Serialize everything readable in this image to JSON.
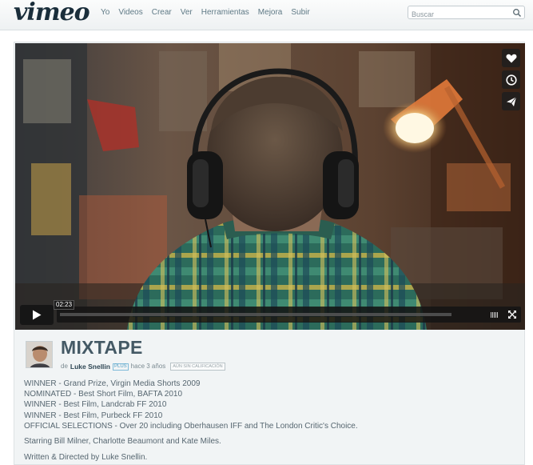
{
  "header": {
    "logo": "vimeo",
    "nav": [
      "Yo",
      "Videos",
      "Crear",
      "Ver",
      "Herramientas",
      "Mejora",
      "Subir"
    ],
    "search_placeholder": "Buscar"
  },
  "player": {
    "elapsed_time": "02:23",
    "side_buttons": [
      "heart-icon",
      "clock-icon",
      "send-icon"
    ]
  },
  "video": {
    "title": "MIXTAPE",
    "by_prefix": "de",
    "author": "Luke Snellin",
    "plus_badge": "PLUS",
    "posted": "hace 3 años",
    "rating_badge": "AÚN SIN CALIFICACIÓN"
  },
  "description": {
    "awards": [
      "WINNER - Grand Prize, Virgin Media Shorts 2009",
      "NOMINATED - Best Short Film, BAFTA 2010",
      "WINNER - Best Film, Landcrab FF 2010",
      "WINNER - Best Film, Purbeck FF 2010",
      "OFFICIAL SELECTIONS - Over 20 including Oberhausen IFF and The London Critic's Choice."
    ],
    "starring": "Starring Bill Milner, Charlotte Beaumont and Kate Miles.",
    "credits": "Written & Directed by Luke Snellin."
  }
}
